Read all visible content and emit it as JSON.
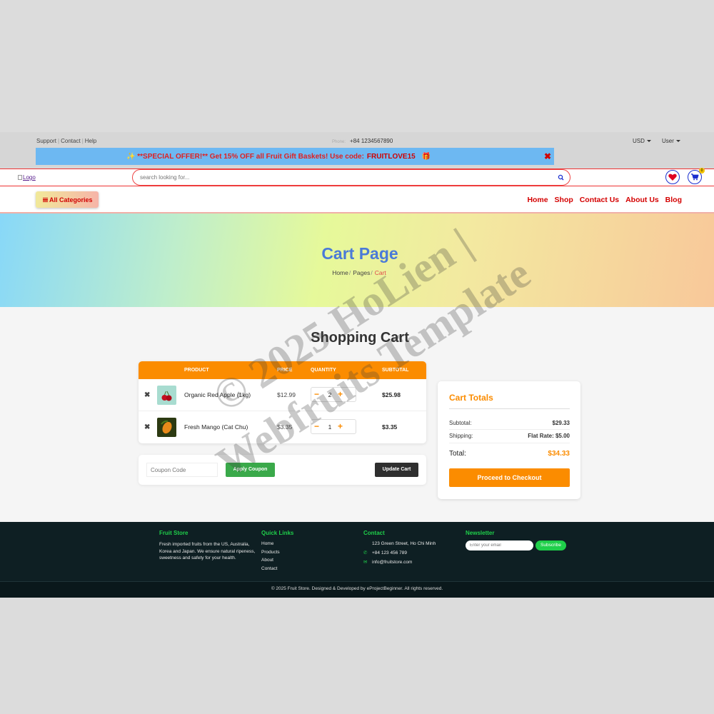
{
  "topbar": {
    "links": [
      "Support",
      "Contact",
      "Help"
    ],
    "phone_label": "Phone:",
    "phone": "+84 1234567890",
    "currency": "USD",
    "user": "User"
  },
  "offer": {
    "text": "✨ **SPECIAL OFFER!** Get 15% OFF all Fruit Gift Baskets! Use code:",
    "code": "FRUITLOVE15",
    "emoji": "🎁",
    "close": "✖"
  },
  "header": {
    "logo_alt": "Logo",
    "search_placeholder": "search looking for...",
    "cart_count": "0"
  },
  "nav": {
    "all_categories": "All Categories",
    "links": [
      "Home",
      "Shop",
      "Contact Us",
      "About Us",
      "Blog"
    ]
  },
  "hero": {
    "title": "Cart Page",
    "breadcrumb": [
      "Home",
      "Pages",
      "Cart"
    ]
  },
  "cart": {
    "title": "Shopping Cart",
    "columns": [
      "PRODUCT",
      "PRICE",
      "QUANTITY",
      "SUBTOTAL"
    ],
    "items": [
      {
        "name": "Organic Red Apple (1kg)",
        "price": "$12.99",
        "qty": "2",
        "subtotal": "$25.98"
      },
      {
        "name": "Fresh Mango (Cat Chu)",
        "price": "$3.35",
        "qty": "1",
        "subtotal": "$3.35"
      }
    ],
    "coupon_placeholder": "Coupon Code",
    "apply_label": "Apply Coupon",
    "update_label": "Update Cart"
  },
  "totals": {
    "title": "Cart Totals",
    "subtotal_label": "Subtotal:",
    "subtotal": "$29.33",
    "shipping_label": "Shipping:",
    "shipping": "Flat Rate: $5.00",
    "total_label": "Total:",
    "total": "$34.33",
    "checkout_label": "Proceed to Checkout"
  },
  "footer": {
    "store_title": "Fruit Store",
    "store_text": "Fresh imported fruits from the US, Australia, Korea and Japan. We ensure natural ripeness, sweetness and safety for your health.",
    "quick_title": "Quick Links",
    "quick_links": [
      "Home",
      "Products",
      "About",
      "Contact"
    ],
    "contact_title": "Contact",
    "address": "123 Green Street, Ho Chi Minh",
    "phone": "+84 123 456 789",
    "email": "info@fruitstore.com",
    "newsletter_title": "Newsletter",
    "newsletter_placeholder": "Enter your email",
    "subscribe_label": "Subscribe",
    "copyright": "© 2025 Fruit Store. Designed & Developed by eProjectBeginner. All rights reserved."
  },
  "watermark": {
    "line1": "© 2025 HoLien |",
    "line2": "Webfruits Template"
  },
  "colors": {
    "accent": "#fb8c00",
    "nav_red": "#d40000",
    "footer_bg": "#0e1f23",
    "footer_green": "#1fcf4a",
    "offer_bg": "#6db8f2"
  }
}
